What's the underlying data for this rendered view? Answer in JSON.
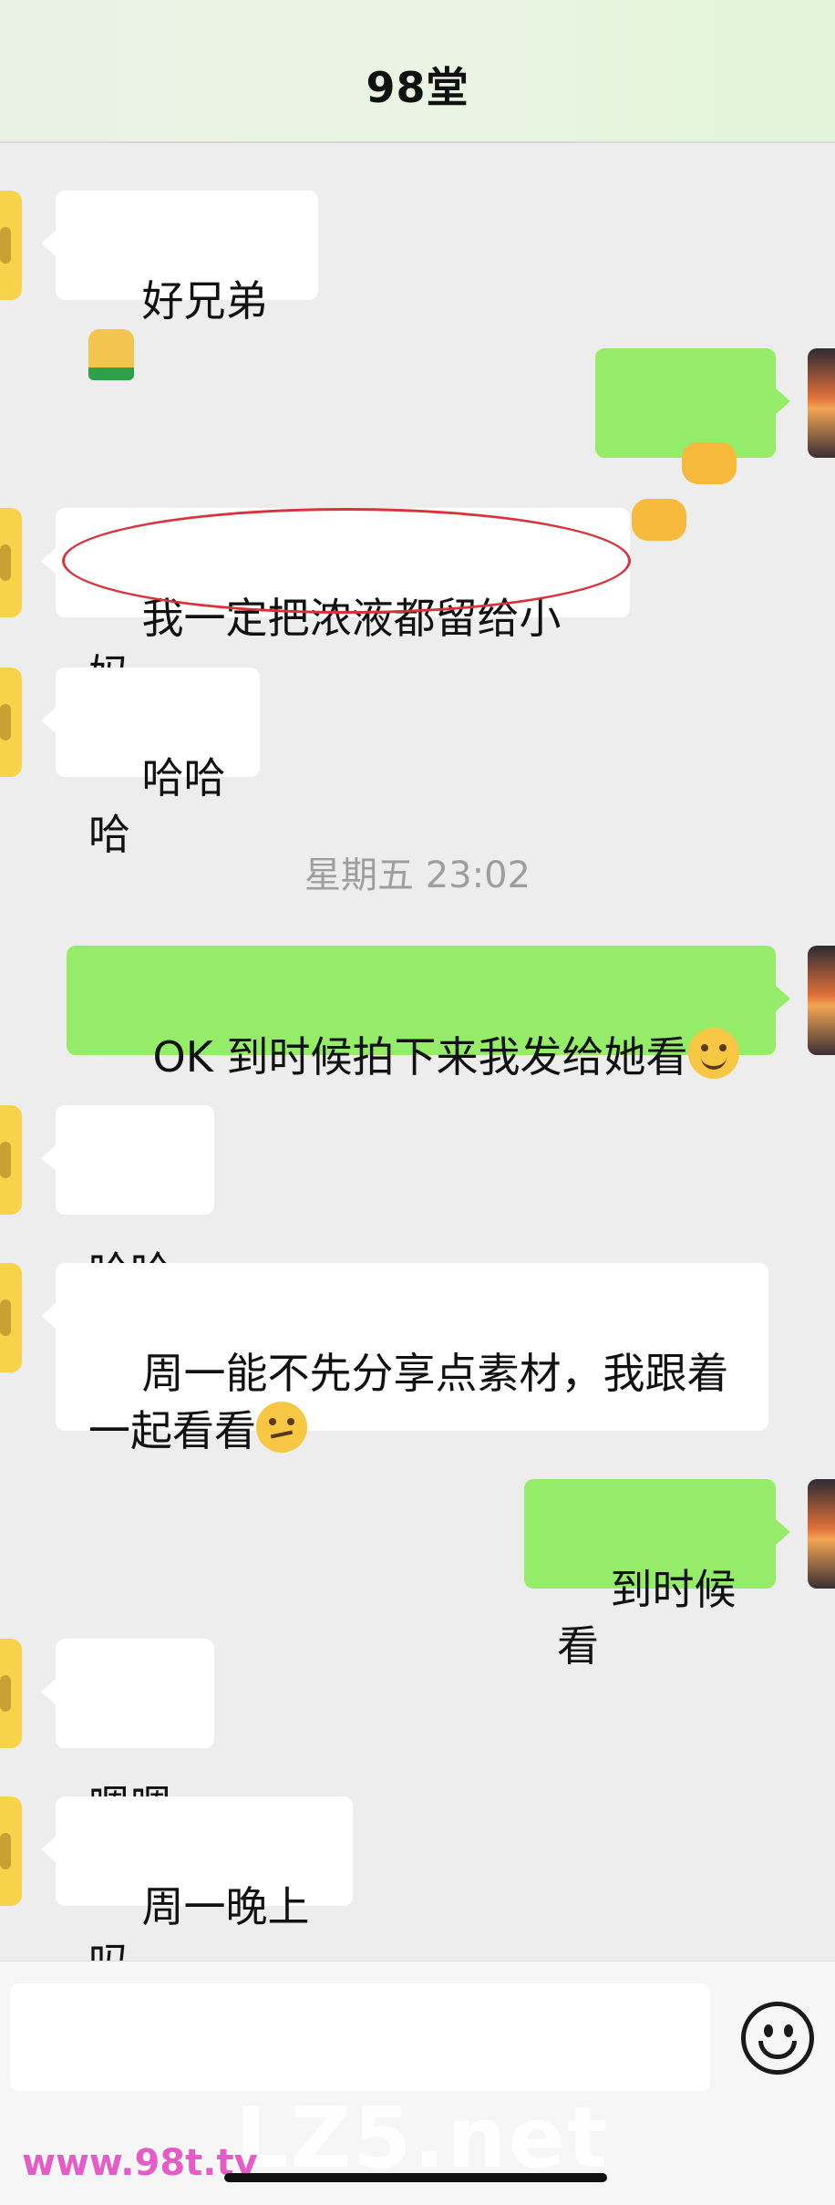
{
  "header": {
    "title": "98堂"
  },
  "messages": [
    {
      "side": "in",
      "text": "好兄弟",
      "emoji": "folded-hands"
    },
    {
      "side": "out",
      "text": "",
      "emoji": "handshake x2"
    },
    {
      "side": "in",
      "text": "我一定把浓液都留给小妈",
      "annotation": "red-ellipse"
    },
    {
      "side": "in",
      "text": "哈哈哈"
    },
    {
      "side": "timestamp",
      "text": "星期五 23:02"
    },
    {
      "side": "out",
      "text": "OK 到时候拍下来我发给她看",
      "emoji": "face-with-hand-over-mouth"
    },
    {
      "side": "in",
      "text": "哈哈"
    },
    {
      "side": "in",
      "text": "周一能不先分享点素材，我跟着\n一起看看",
      "emoji": "smirking-face"
    },
    {
      "side": "out",
      "text": "到时候看"
    },
    {
      "side": "in",
      "text": "嗯嗯"
    },
    {
      "side": "in",
      "text": "周一晚上吗"
    }
  ],
  "input_bar": {
    "input_value": "",
    "emoji_icon": "smiley-face-icon"
  },
  "watermarks": {
    "left": "www.98t.tv",
    "right": "LZ5.net"
  },
  "colors": {
    "outgoing_bubble": "#95ec69",
    "incoming_bubble": "#ffffff",
    "background": "#ededed"
  }
}
